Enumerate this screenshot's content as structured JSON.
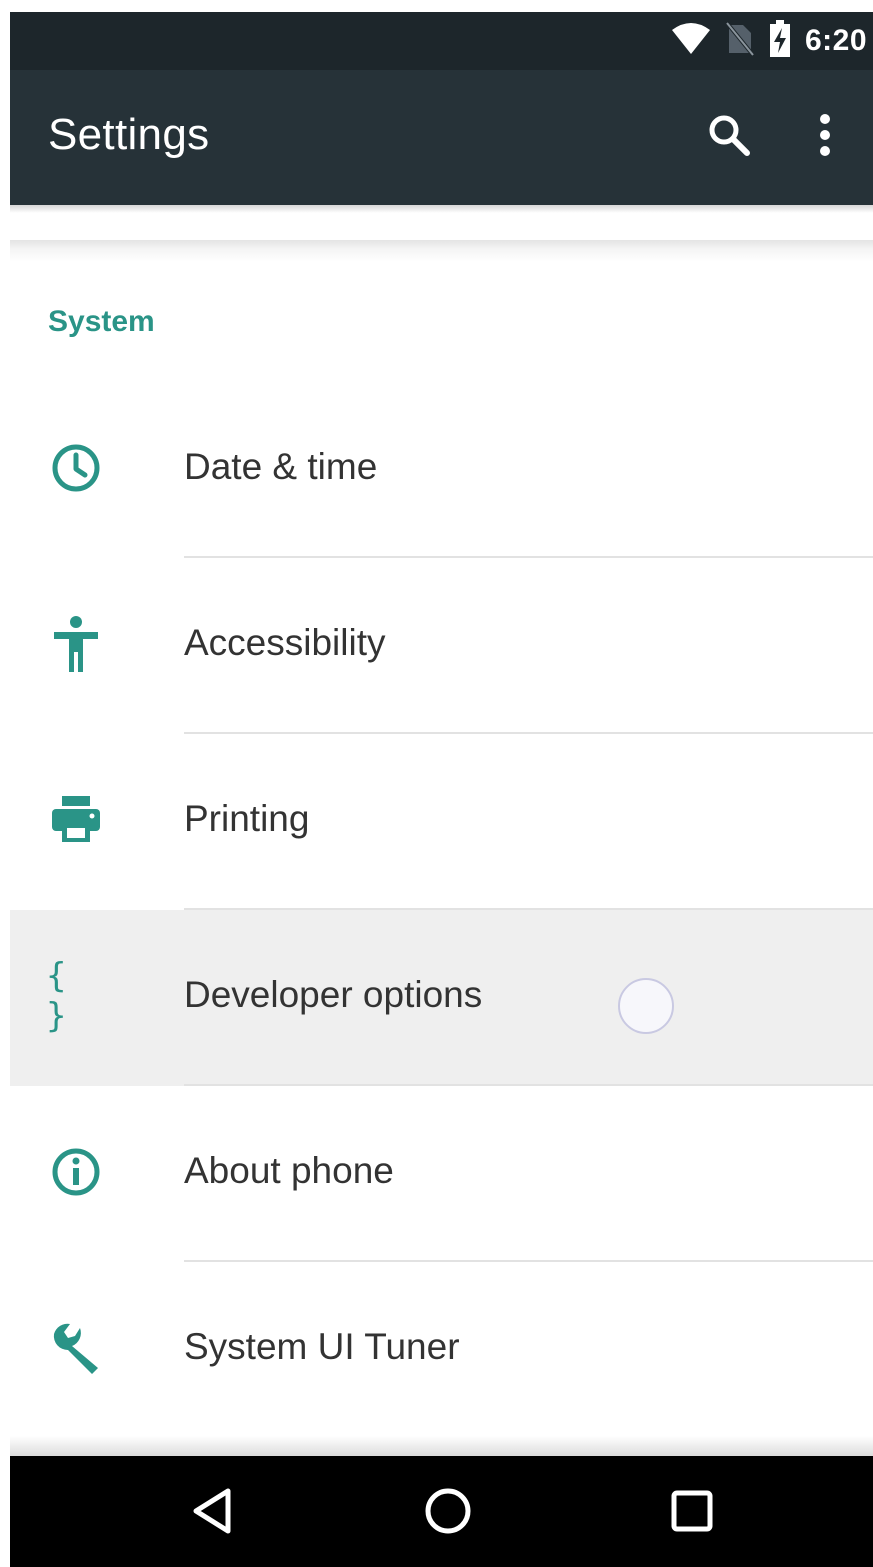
{
  "status_bar": {
    "time": "6:20",
    "icons": [
      "wifi-icon",
      "no-sim-icon",
      "battery-charging-icon"
    ]
  },
  "app_bar": {
    "title": "Settings",
    "actions": [
      "search-icon",
      "more-vert-icon"
    ]
  },
  "section": {
    "header": "System"
  },
  "items": [
    {
      "label": "Date & time",
      "icon": "clock-icon"
    },
    {
      "label": "Accessibility",
      "icon": "accessibility-icon"
    },
    {
      "label": "Printing",
      "icon": "print-icon"
    },
    {
      "label": "Developer options",
      "icon": "code-braces-icon",
      "icon_text": "{ }",
      "pressed": true
    },
    {
      "label": "About phone",
      "icon": "info-icon"
    },
    {
      "label": "System UI Tuner",
      "icon": "wrench-icon"
    }
  ],
  "nav_bar": {
    "buttons": [
      "back-icon",
      "home-icon",
      "recents-icon"
    ]
  },
  "colors": {
    "accent": "#2a9487",
    "app_bar": "#263238",
    "status_bar": "#1d262b",
    "text": "#333333",
    "nav_bar": "#000000"
  }
}
